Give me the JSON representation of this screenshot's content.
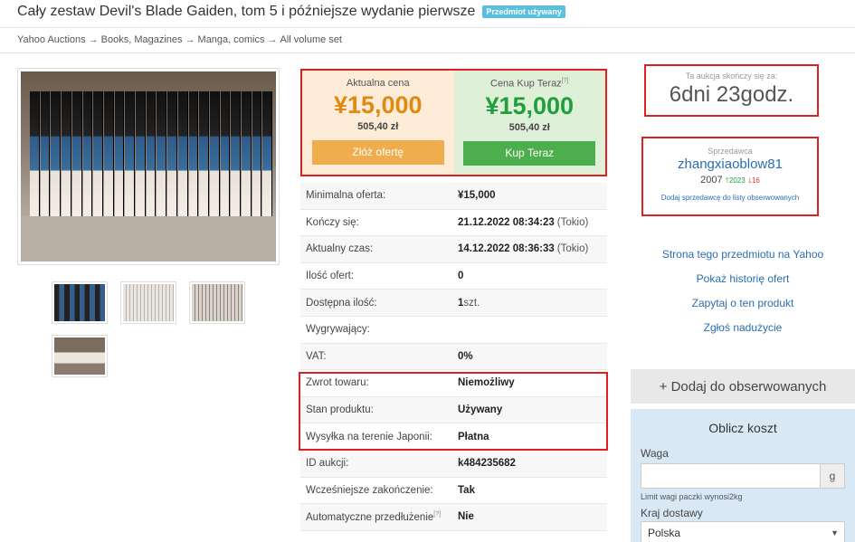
{
  "header": {
    "title": "Cały zestaw Devil's Blade Gaiden, tom 5 i późniejsze wydanie pierwsze",
    "badge": "Przedmiot używany"
  },
  "breadcrumb": [
    "Yahoo Auctions",
    "Books, Magazines",
    "Manga, comics",
    "All volume set"
  ],
  "breadcrumb_sep": "→",
  "price": {
    "current_label": "Aktualna cena",
    "current_value": "¥15,000",
    "current_pln": "505,40 zł",
    "bid_button": "Złóż ofertę",
    "buynow_label": "Cena Kup Teraz",
    "buynow_help": "[?]",
    "buynow_value": "¥15,000",
    "buynow_pln": "505,40 zł",
    "buynow_button": "Kup Teraz"
  },
  "details": [
    {
      "k": "Minimalna oferta:",
      "v": "¥15,000",
      "tz": ""
    },
    {
      "k": "Kończy się:",
      "v": "21.12.2022 08:34:23",
      "tz": "(Tokio)"
    },
    {
      "k": "Aktualny czas:",
      "v": "14.12.2022 08:36:33",
      "tz": "(Tokio)"
    },
    {
      "k": "Ilość ofert:",
      "v": "0",
      "tz": ""
    },
    {
      "k": "Dostępna ilość:",
      "v": "1",
      "tz": "szt."
    },
    {
      "k": "Wygrywający:",
      "v": "",
      "tz": ""
    },
    {
      "k": "VAT:",
      "v": "0%",
      "tz": ""
    },
    {
      "k": "Zwrot towaru:",
      "v": "Niemożliwy",
      "tz": ""
    },
    {
      "k": "Stan produktu:",
      "v": "Używany",
      "tz": ""
    },
    {
      "k": "Wysyłka na terenie Japonii:",
      "v": "Płatna",
      "tz": ""
    },
    {
      "k": "ID aukcji:",
      "v": "k484235682",
      "tz": ""
    },
    {
      "k": "Wcześniejsze zakończenie:",
      "v": "Tak",
      "tz": ""
    },
    {
      "k": "Automatyczne przedłużenie",
      "v": "Nie",
      "tz": "",
      "help": "[?]"
    }
  ],
  "timer": {
    "label": "Ta aukcja skończy się za:",
    "value": "6dni 23godz."
  },
  "seller": {
    "label": "Sprzedawca",
    "name": "zhangxiaoblow81",
    "year": "2007",
    "positive": "2023",
    "negative": "16",
    "watch_link": "Dodaj sprzedawcę do listy obserwowanych"
  },
  "links": [
    "Strona tego przedmiotu na Yahoo",
    "Pokaż historię ofert",
    "Zapytaj o ten produkt",
    "Zgłoś nadużycie"
  ],
  "watch_button": "+ Dodaj do obserwowanych",
  "calc": {
    "title": "Oblicz koszt",
    "weight_label": "Waga",
    "unit": "g",
    "hint": "Limit wagi paczki wynosi2kg",
    "country_label": "Kraj dostawy",
    "country_value": "Polska"
  }
}
